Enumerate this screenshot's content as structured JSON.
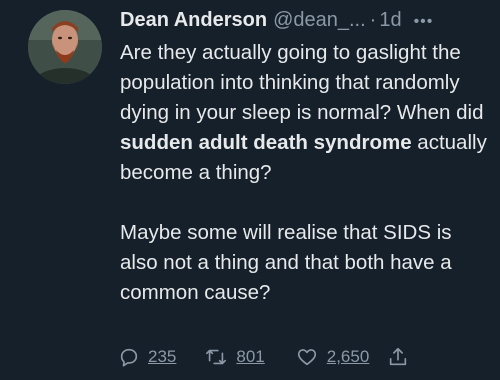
{
  "tweet": {
    "author_name": "Dean Anderson",
    "handle": "@dean_...",
    "separator": "·",
    "time": "1d",
    "more_icon": "ellipsis-icon",
    "paragraph1": {
      "text_a": "Are they actually going to gaslight the population into thinking that randomly dying in your sleep is normal? When did ",
      "bold": "sudden adult death syndrome",
      "text_b": " actually become a thing?"
    },
    "paragraph2": "Maybe some will realise that SIDS is also not a thing and that both have a common cause?",
    "actions": {
      "reply_icon": "reply-icon",
      "reply_count": "235",
      "retweet_icon": "retweet-icon",
      "retweet_count": "801",
      "like_icon": "heart-icon",
      "like_count": "2,650",
      "share_icon": "share-icon"
    }
  },
  "colors": {
    "background": "#15202b",
    "text_primary": "#e7e9ea",
    "text_secondary": "#8b98a5"
  }
}
